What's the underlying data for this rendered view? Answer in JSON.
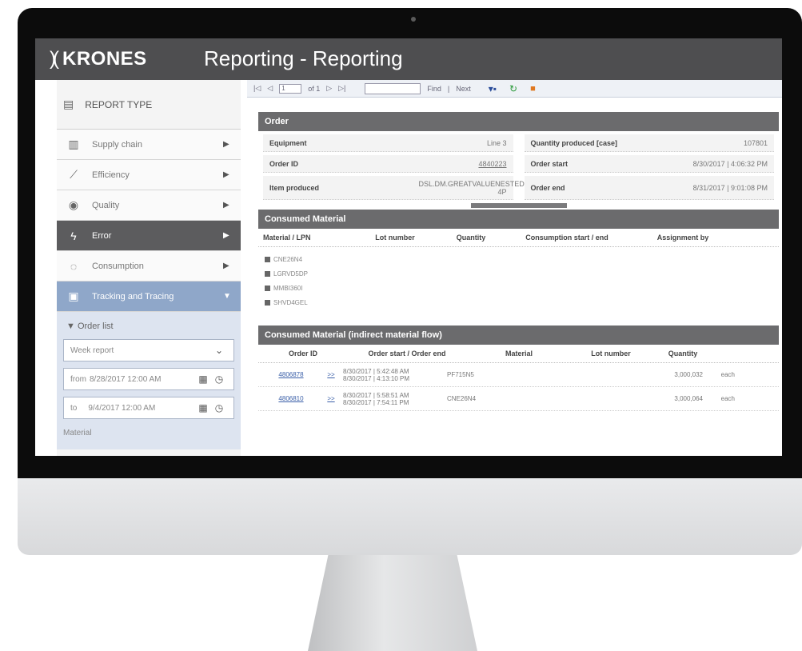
{
  "header": {
    "brand": "KRONES",
    "title": "Reporting  -  Reporting"
  },
  "sidebar": {
    "heading": "REPORT TYPE",
    "items": [
      {
        "label": "Supply chain",
        "icon": "bar-chart-icon",
        "glyph": "📊"
      },
      {
        "label": "Efficiency",
        "icon": "line-chart-icon",
        "glyph": "📈"
      },
      {
        "label": "Quality",
        "icon": "eye-icon",
        "glyph": "👁"
      },
      {
        "label": "Error",
        "icon": "lightning-icon",
        "glyph": "⚡"
      },
      {
        "label": "Consumption",
        "icon": "cycle-icon",
        "glyph": "◌"
      },
      {
        "label": "Tracking and Tracing",
        "icon": "document-icon",
        "glyph": "▣"
      }
    ],
    "order_list": "Order list",
    "report_select": "Week report",
    "from_label": "from",
    "from_value": "8/28/2017 12:00 AM",
    "to_label": "to",
    "to_value": "9/4/2017 12:00 AM",
    "material_label": "Material"
  },
  "toolbar": {
    "first": "|◁",
    "prev": "◁",
    "page": "1",
    "of": "of 1",
    "next": "▷",
    "last": "▷|",
    "find": "Find",
    "next_label": "Next"
  },
  "order": {
    "title": "Order",
    "equipment_label": "Equipment",
    "equipment_value": "Line 3",
    "qty_label": "Quantity produced [case]",
    "qty_value": "107801",
    "order_id_label": "Order ID",
    "order_id_value": "4840223",
    "order_start_label": "Order start",
    "order_start_value": "8/30/2017 | 4:06:32 PM",
    "item_label": "Item produced",
    "item_value": "DSL.DM.GREATVALUENESTED.2 4P",
    "order_end_label": "Order end",
    "order_end_value": "8/31/2017 | 9:01:08 PM"
  },
  "consumed": {
    "title": "Consumed Material",
    "columns": [
      "Material / LPN",
      "Lot number",
      "Quantity",
      "Consumption start / end",
      "Assignment by"
    ],
    "lpns": [
      "CNE26N4",
      "LGRVD5DP",
      "MMBI360I",
      "SHVD4GEL"
    ]
  },
  "indirect": {
    "title": "Consumed Material (indirect material flow)",
    "columns": [
      "Order ID",
      "Order start / Order end",
      "Material",
      "Lot number",
      "Quantity"
    ],
    "rows": [
      {
        "id": "4806878",
        "arrow": ">>",
        "start": "8/30/2017 | 5:42:48 AM",
        "end": "8/30/2017 | 4:13:10 PM",
        "material": "PF715N5",
        "qty": "3,000,032",
        "unit": "each"
      },
      {
        "id": "4806810",
        "arrow": ">>",
        "start": "8/30/2017 | 5:58:51 AM",
        "end": "8/30/2017 | 7:54:11 PM",
        "material": "CNE26N4",
        "qty": "3,000,064",
        "unit": "each"
      }
    ]
  }
}
